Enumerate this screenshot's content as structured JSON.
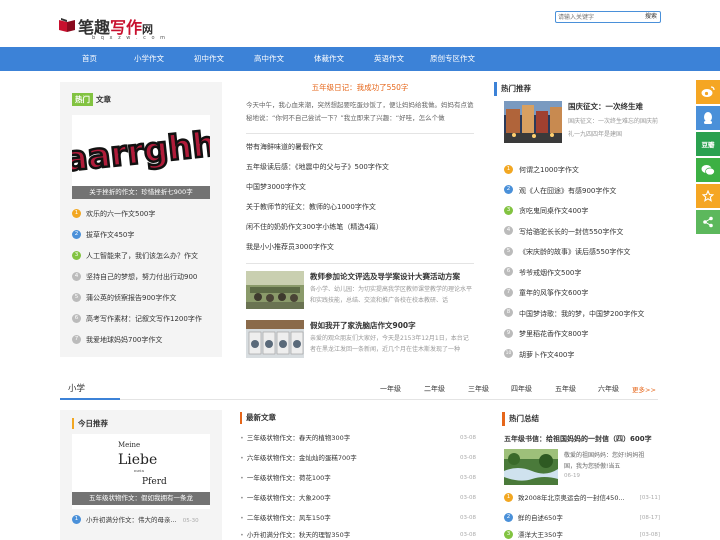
{
  "header": {
    "logo_text_a": "笔趣",
    "logo_text_b": "写作",
    "logo_text_c": "网",
    "logo_sub": "b q x z w . c o m",
    "search_placeholder": "请输入关键字",
    "search_button": "搜索"
  },
  "nav": {
    "items": [
      "首页",
      "小学作文",
      "初中作文",
      "高中作文",
      "体裁作文",
      "英语作文",
      "原创专区作文"
    ]
  },
  "hot": {
    "tag_a": "热门",
    "tag_b": "文章",
    "feature_img_text": "aarrghh",
    "feature_caption": "关于挫折的作文：珍惜挫折七900字",
    "items": [
      {
        "n": "1",
        "text": "欢乐的六一作文500字"
      },
      {
        "n": "2",
        "text": "拔草作文450字"
      },
      {
        "n": "3",
        "text": "人工智能来了，我们该怎么办？作文"
      },
      {
        "n": "4",
        "text": "坚持自己的梦想，努力付出行动900"
      },
      {
        "n": "5",
        "text": "蒲公英的侦察报告900字作文"
      },
      {
        "n": "6",
        "text": "高考写作素材：记叙文写作1200字作"
      },
      {
        "n": "7",
        "text": "我爱地球妈妈700字作文"
      }
    ]
  },
  "middle": {
    "title": "五年级日记：我成功了550字",
    "summary": "今天中午，我心血来潮，突然想起要吃蛋炒饭了，便让妈妈给我做。妈妈有点诡秘地说：“你何不自己尝试一下？”我立即来了兴趣：“好哇，怎么个做",
    "items": [
      "带有海鲜味道的暑假作文",
      "五年级读后感：《地震中的父与子》500字作文",
      "中国梦3000字作文",
      "关于教师节的征文：教师的心1000字作文",
      "闲不住的奶奶作文300字小练笔（精选4篇）",
      "我是小小推荐员3000字作文"
    ],
    "img_articles": [
      {
        "title": "教师参加论文评选及导学案设计大赛活动方案",
        "desc": "各小学、幼儿园：为切实提高我学区教师课堂教学的理论水平和实践技能，总结、交流和推广各校在校本教研、话"
      },
      {
        "title": "假如我开了家洗脑店作文900字",
        "desc": "亲爱的观众朋友们大家好，今天是2153年12月1日，本台记者在黑龙江发回一条新闻，近几个月在佳木斯发现了一种"
      }
    ]
  },
  "right": {
    "head": "热门推荐",
    "feat_title": "国庆征文：一次终生难",
    "feat_desc": "国庆征文：一次终生难忘的国庆前礼一九四四年是建国",
    "items": [
      {
        "n": "1",
        "text": "何谓之1000字作文"
      },
      {
        "n": "2",
        "text": "观《人在囧途》有感900字作文"
      },
      {
        "n": "3",
        "text": "贪吃鬼同桌作文400字"
      },
      {
        "n": "4",
        "text": "写给骆驼长长的一封信550字作文"
      },
      {
        "n": "5",
        "text": "《宋庆龄的故事》读后感550字作文"
      },
      {
        "n": "6",
        "text": "爷爷戒烟作文500字"
      },
      {
        "n": "7",
        "text": "童年的风筝作文600字"
      },
      {
        "n": "8",
        "text": "中国梦诗歌：我的梦，中国梦200字作文"
      },
      {
        "n": "9",
        "text": "梦里稻花香作文800字"
      },
      {
        "n": "10",
        "text": "胡萝卜作文400字"
      }
    ]
  },
  "section2": {
    "title": "小学",
    "grades": [
      "一年级",
      "二年级",
      "三年级",
      "四年级",
      "五年级",
      "六年级"
    ],
    "more": "更多>>"
  },
  "today": {
    "head": "今日推荐",
    "img_lines": [
      "Meine",
      "Liebe",
      "Pferd"
    ],
    "img_small": "mein",
    "caption": "五年级状物作文：假如我拥有一条龙",
    "items": [
      {
        "n": "1",
        "text": "小升初满分作文：伟大的母亲...",
        "date": "05-30"
      }
    ]
  },
  "latest": {
    "head": "最新文章",
    "items": [
      {
        "text": "三年级状物作文：春天的植物300字",
        "date": "03-08"
      },
      {
        "text": "六年级状物作文：金灿灿的蛋糕700字",
        "date": "03-08"
      },
      {
        "text": "一年级状物作文：荷花100字",
        "date": "03-08"
      },
      {
        "text": "一年级状物作文：大象200字",
        "date": "03-08"
      },
      {
        "text": "二年级状物作文：风车150字",
        "date": "03-08"
      },
      {
        "text": "小升初满分作文：秋天的理智350字",
        "date": "03-08"
      }
    ]
  },
  "hot_summary": {
    "head": "热门总结",
    "title": "五年级书信：给祖国妈妈的一封信（四）600字",
    "desc": "敬爱的祖国妈妈：您好!妈妈祖国，我为您骄傲!当五",
    "date": "06-19",
    "items": [
      {
        "n": "1",
        "text": "致2008年北京奥运会的一封信450...",
        "date": "[03-11]"
      },
      {
        "n": "2",
        "text": "鲜的自述650字",
        "date": "[08-17]"
      },
      {
        "n": "3",
        "text": "漂洋大王350字",
        "date": "[03-08]"
      }
    ]
  },
  "share": {
    "items": [
      {
        "name": "weibo",
        "label": "微博",
        "color": "#f5a623"
      },
      {
        "name": "qq",
        "label": "QQ",
        "color": "#4a90d9"
      },
      {
        "name": "douban",
        "label": "豆瓣",
        "color": "#2aa14f"
      },
      {
        "name": "wechat",
        "label": "微信",
        "color": "#3cb043"
      },
      {
        "name": "favorite",
        "label": "收藏",
        "color": "#f5a623"
      },
      {
        "name": "share",
        "label": "分享",
        "color": "#5cb85c"
      }
    ]
  },
  "colors": {
    "nav": "#3c82d7",
    "accent_orange": "#e6661a",
    "hot_green": "#82c341",
    "rank1": "#f2a722",
    "rank2": "#4a90d9",
    "rank3": "#82c341",
    "rank_other": "#bbbbbb"
  }
}
